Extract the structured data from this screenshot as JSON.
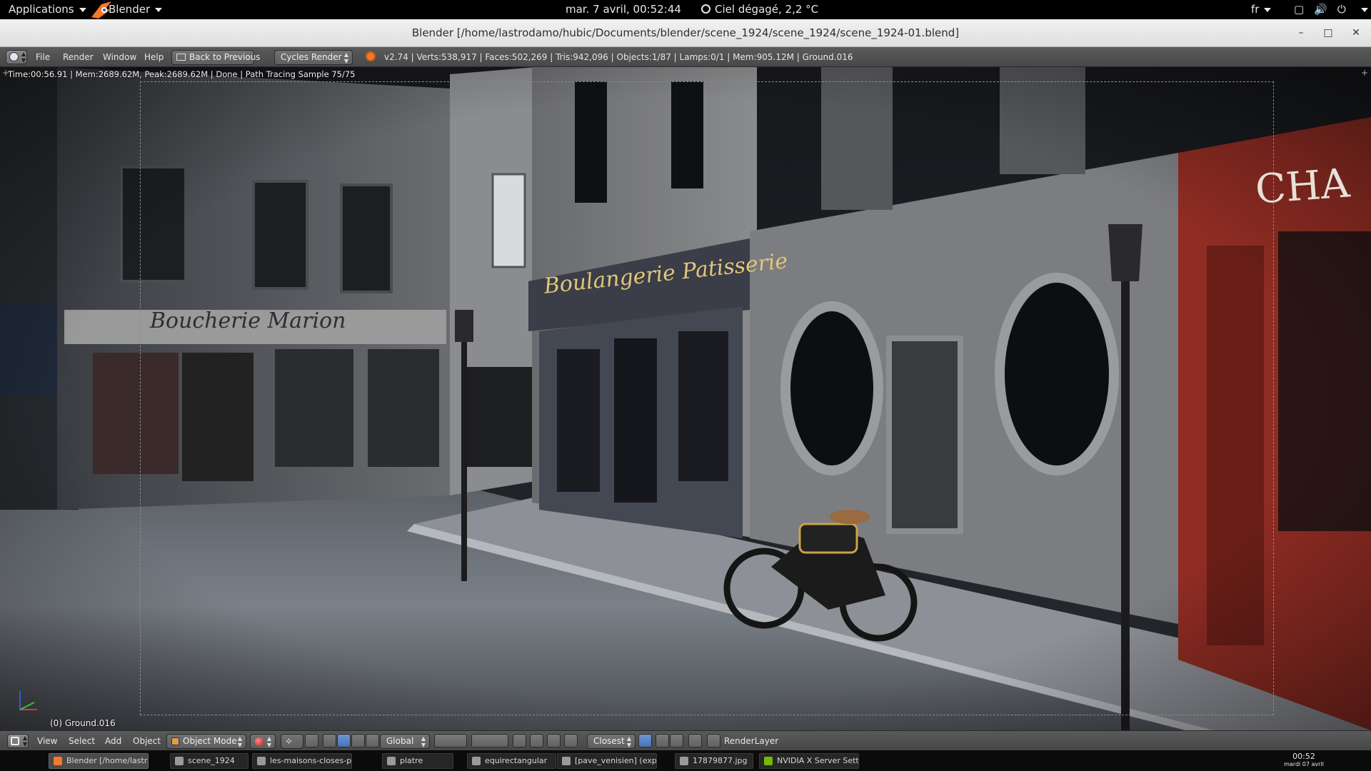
{
  "gnome_bar": {
    "applications": "Applications",
    "app_menu": "Blender",
    "clock": "mar.  7 avril, 00:52:44",
    "weather": "Ciel dégagé, 2,2 °C",
    "language": "fr"
  },
  "window": {
    "title": "Blender [/home/lastrodamo/hubic/Documents/blender/scene_1924/scene_1924/scene_1924-01.blend]"
  },
  "info_header": {
    "menus": [
      "File",
      "Render",
      "Window",
      "Help"
    ],
    "back_button": "Back to Previous",
    "render_engine": "Cycles Render",
    "stats": "v2.74 | Verts:538,917 | Faces:502,269 | Tris:942,096 | Objects:1/87 | Lamps:0/1 | Mem:905.12M | Ground.016"
  },
  "render_view": {
    "status": "Time:00:56.91 | Mem:2689.62M, Peak:2689.62M | Done | Path Tracing Sample 75/75",
    "active_object": "(0) Ground.016",
    "scene_text": {
      "boucherie": "Boucherie  Marion",
      "boulangerie": "Boulangerie  Patisserie",
      "cha": "CHA"
    }
  },
  "view3d_header": {
    "menus": [
      "View",
      "Select",
      "Add",
      "Object"
    ],
    "mode": "Object Mode",
    "orientation": "Global",
    "snap": "Closest",
    "render_layer": "RenderLayer"
  },
  "taskbar": {
    "tasks": [
      "Blender [/home/lastr...",
      "scene_1924",
      "les-maisons-closes-p...",
      "platre",
      "equirectangular",
      "[pave_venisien] (exp...",
      "17879877.jpg",
      "NVIDIA X Server Sett..."
    ],
    "clock_time": "00:52",
    "clock_date": "mardi 07 avril"
  },
  "colors": {
    "blender_orange": "#f5792a",
    "header_gray": "#505050",
    "storefront_red": "#8f2c23"
  }
}
